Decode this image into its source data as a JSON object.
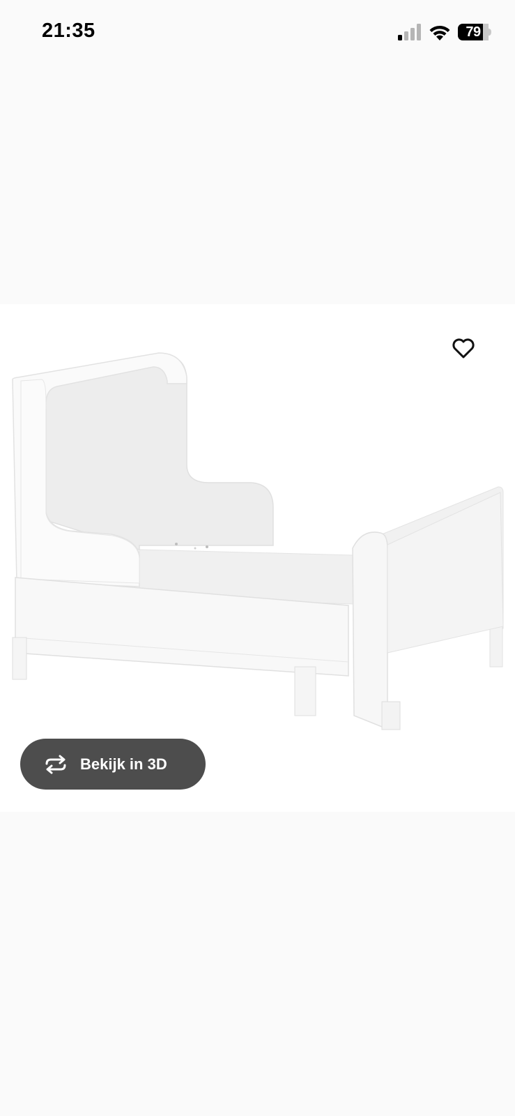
{
  "status_bar": {
    "time": "21:35",
    "battery_level": "79",
    "icons": [
      "signal-icon",
      "wifi-icon",
      "battery-icon"
    ]
  },
  "product": {
    "image": "children-extendable-bed-white",
    "favorite_icon": "heart-outline-icon",
    "view_3d": {
      "label": "Bekijk in 3D",
      "icon": "rotate-arrows-icon"
    }
  },
  "colors": {
    "page_background": "#fafafa",
    "gallery_background": "#ffffff",
    "button_background": "#4d4d4d",
    "button_text": "#ffffff"
  }
}
